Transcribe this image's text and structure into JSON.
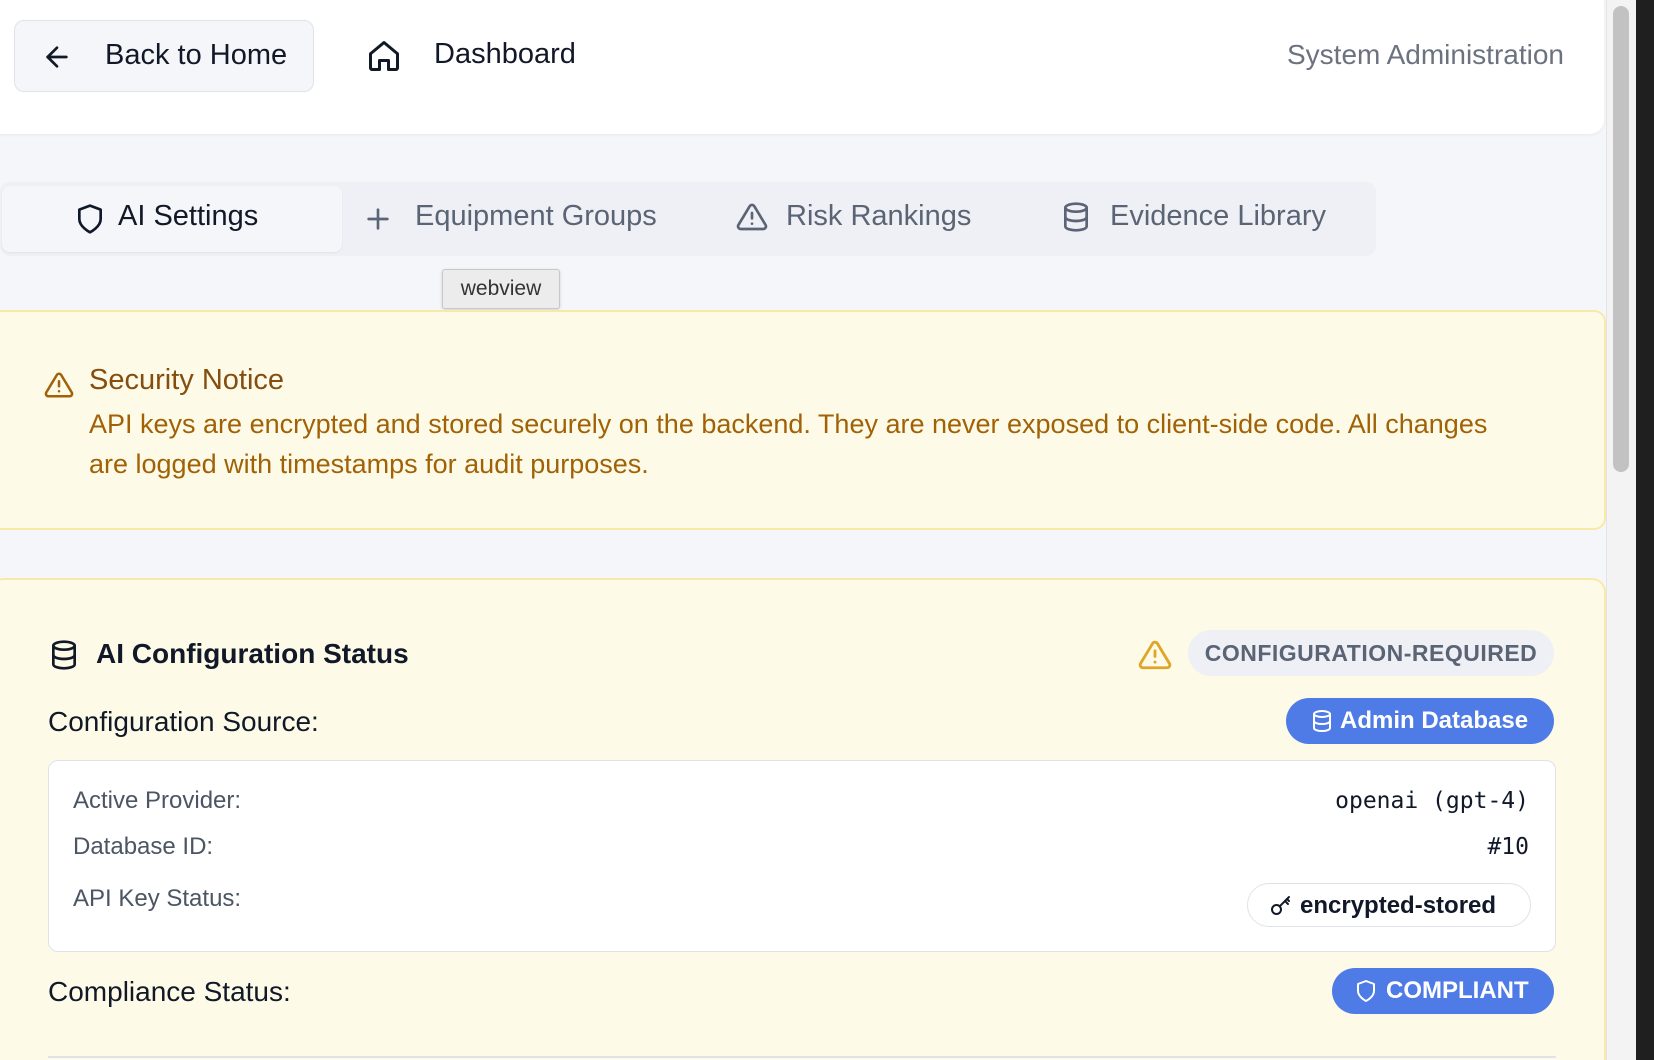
{
  "header": {
    "back_label": "Back to Home",
    "dashboard_label": "Dashboard",
    "right_label": "System Administration"
  },
  "tabs": [
    {
      "label": "AI Settings",
      "icon": "shield-icon",
      "active": true
    },
    {
      "label": "Equipment Groups",
      "icon": "plus-icon",
      "active": false
    },
    {
      "label": "Risk Rankings",
      "icon": "warning-triangle-icon",
      "active": false
    },
    {
      "label": "Evidence Library",
      "icon": "database-icon",
      "active": false
    }
  ],
  "tooltip": "webview",
  "notice": {
    "title": "Security Notice",
    "text": "API keys are encrypted and stored securely on the backend. They are never exposed to client-side code. All changes are logged with timestamps for audit purposes."
  },
  "config": {
    "title": "AI Configuration Status",
    "status": "CONFIGURATION-REQUIRED",
    "source_label": "Configuration Source:",
    "source_value": "Admin Database",
    "details": [
      {
        "label": "Active Provider:",
        "value": "openai (gpt-4)"
      },
      {
        "label": "Database ID:",
        "value": "#10"
      },
      {
        "label": "API Key Status:",
        "value": "encrypted-stored"
      }
    ],
    "compliance_label": "Compliance Status:",
    "compliance_value": "COMPLIANT"
  },
  "colors": {
    "accent_blue": "#4f7be6",
    "notice_bg": "#fdfbe7",
    "notice_border": "#f8e9a6",
    "notice_text": "#a16207",
    "warning_icon": "#e0a526"
  }
}
